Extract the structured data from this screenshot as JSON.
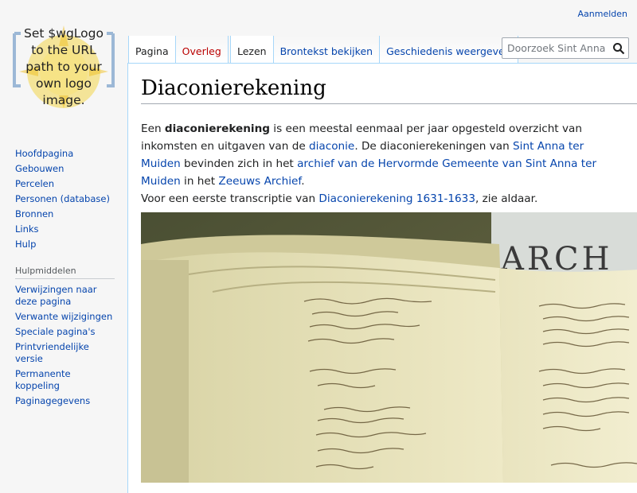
{
  "personal": {
    "login": "Aanmelden"
  },
  "logo": {
    "lines": [
      "Set $wgLogo",
      "to the URL",
      "path to your",
      "own logo",
      "image."
    ]
  },
  "tabs": {
    "namespaces": [
      {
        "label": "Pagina",
        "selected": true
      },
      {
        "label": "Overleg",
        "selected": false
      }
    ],
    "views": [
      {
        "label": "Lezen"
      },
      {
        "label": "Brontekst bekijken"
      },
      {
        "label": "Geschiedenis weergeven"
      }
    ]
  },
  "search": {
    "placeholder": "Doorzoek Sint Anna",
    "value": ""
  },
  "sidebar": {
    "navigation": [
      {
        "label": "Hoofdpagina"
      },
      {
        "label": "Gebouwen"
      },
      {
        "label": "Percelen"
      },
      {
        "label": "Personen (database)"
      },
      {
        "label": "Bronnen"
      },
      {
        "label": "Links"
      },
      {
        "label": "Hulp"
      }
    ],
    "toolbox": {
      "heading": "Hulpmiddelen",
      "items": [
        {
          "label": "Verwijzingen naar deze pagina"
        },
        {
          "label": "Verwante wijzigingen"
        },
        {
          "label": "Speciale pagina's"
        },
        {
          "label": "Printvriendelijke versie"
        },
        {
          "label": "Permanente koppeling"
        },
        {
          "label": "Paginagegevens"
        }
      ]
    }
  },
  "content": {
    "title": "Diaconierekening",
    "p1": {
      "t1": "Een ",
      "bold": "diaconierekening",
      "t2": " is een meestal eenmaal per jaar opgesteld overzicht van inkomsten en uitgaven van de ",
      "link1": "diaconie",
      "t3": ". De diaconierekeningen van ",
      "link2": "Sint Anna ter Muiden",
      "t4": " bevinden zich in het ",
      "link3": "archief van de Hervormde Gemeente van Sint Anna ter Muiden",
      "t5": " in het ",
      "link4": "Zeeuws Archief",
      "t6": "."
    },
    "p2": {
      "t1": "Voor een eerste transcriptie van ",
      "link1": "Diaconierekening 1631-1633",
      "t2": ", zie aldaar."
    },
    "image": {
      "caption_text": "ARCH"
    }
  }
}
